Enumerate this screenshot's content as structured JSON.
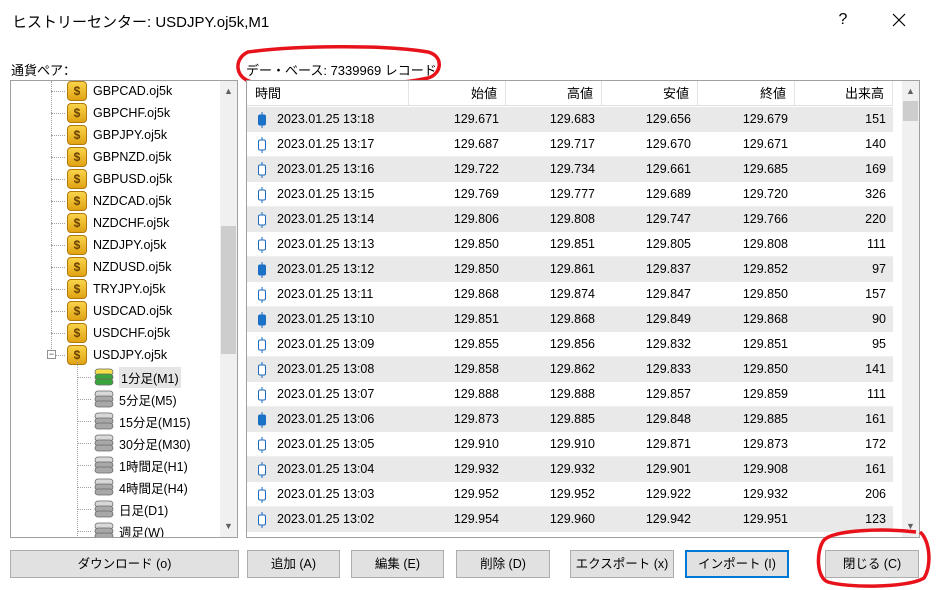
{
  "window": {
    "title": "ヒストリーセンター: USDJPY.oj5k,M1",
    "help_label": "?"
  },
  "left_label": "通貨ペア：",
  "db_info": "デー・ベース: 7339969 レコード",
  "tree": {
    "symbols": [
      "GBPCAD.oj5k",
      "GBPCHF.oj5k",
      "GBPJPY.oj5k",
      "GBPNZD.oj5k",
      "GBPUSD.oj5k",
      "NZDCAD.oj5k",
      "NZDCHF.oj5k",
      "NZDJPY.oj5k",
      "NZDUSD.oj5k",
      "TRYJPY.oj5k",
      "USDCAD.oj5k",
      "USDCHF.oj5k",
      "USDJPY.oj5k"
    ],
    "expander_symbol": "−",
    "timeframes": [
      "1分足(M1)",
      "5分足(M5)",
      "15分足(M15)",
      "30分足(M30)",
      "1時間足(H1)",
      "4時間足(H4)",
      "日足(D1)",
      "週足(W)"
    ],
    "selected_timeframe": "1分足(M1)",
    "scroll_up": "▲",
    "scroll_down": "▼"
  },
  "table": {
    "headers": [
      "時間",
      "始値",
      "高値",
      "安値",
      "終値",
      "出来高"
    ],
    "rows": [
      [
        "2023.01.25 13:18",
        "129.671",
        "129.683",
        "129.656",
        "129.679",
        "151"
      ],
      [
        "2023.01.25 13:17",
        "129.687",
        "129.717",
        "129.670",
        "129.671",
        "140"
      ],
      [
        "2023.01.25 13:16",
        "129.722",
        "129.734",
        "129.661",
        "129.685",
        "169"
      ],
      [
        "2023.01.25 13:15",
        "129.769",
        "129.777",
        "129.689",
        "129.720",
        "326"
      ],
      [
        "2023.01.25 13:14",
        "129.806",
        "129.808",
        "129.747",
        "129.766",
        "220"
      ],
      [
        "2023.01.25 13:13",
        "129.850",
        "129.851",
        "129.805",
        "129.808",
        "111"
      ],
      [
        "2023.01.25 13:12",
        "129.850",
        "129.861",
        "129.837",
        "129.852",
        "97"
      ],
      [
        "2023.01.25 13:11",
        "129.868",
        "129.874",
        "129.847",
        "129.850",
        "157"
      ],
      [
        "2023.01.25 13:10",
        "129.851",
        "129.868",
        "129.849",
        "129.868",
        "90"
      ],
      [
        "2023.01.25 13:09",
        "129.855",
        "129.856",
        "129.832",
        "129.851",
        "95"
      ],
      [
        "2023.01.25 13:08",
        "129.858",
        "129.862",
        "129.833",
        "129.850",
        "141"
      ],
      [
        "2023.01.25 13:07",
        "129.888",
        "129.888",
        "129.857",
        "129.859",
        "111"
      ],
      [
        "2023.01.25 13:06",
        "129.873",
        "129.885",
        "129.848",
        "129.885",
        "161"
      ],
      [
        "2023.01.25 13:05",
        "129.910",
        "129.910",
        "129.871",
        "129.873",
        "172"
      ],
      [
        "2023.01.25 13:04",
        "129.932",
        "129.932",
        "129.901",
        "129.908",
        "161"
      ],
      [
        "2023.01.25 13:03",
        "129.952",
        "129.952",
        "129.922",
        "129.932",
        "206"
      ],
      [
        "2023.01.25 13:02",
        "129.954",
        "129.960",
        "129.942",
        "129.951",
        "123"
      ]
    ],
    "scroll_up": "▲",
    "scroll_down": "▼"
  },
  "buttons": {
    "download": "ダウンロード (o)",
    "add": "追加 (A)",
    "edit": "編集 (E)",
    "delete": "削除 (D)",
    "export": "エクスポート (x)",
    "import": "インポート (I)",
    "close": "閉じる (C)"
  },
  "colors": {
    "bull_candle": "#1a73c9",
    "bear_candle": "#ffffff",
    "candle_outline": "#1a6bbf",
    "annotation_red": "#e8121b",
    "focus_border": "#0078d7",
    "coin_gold": "#f2c12e"
  }
}
